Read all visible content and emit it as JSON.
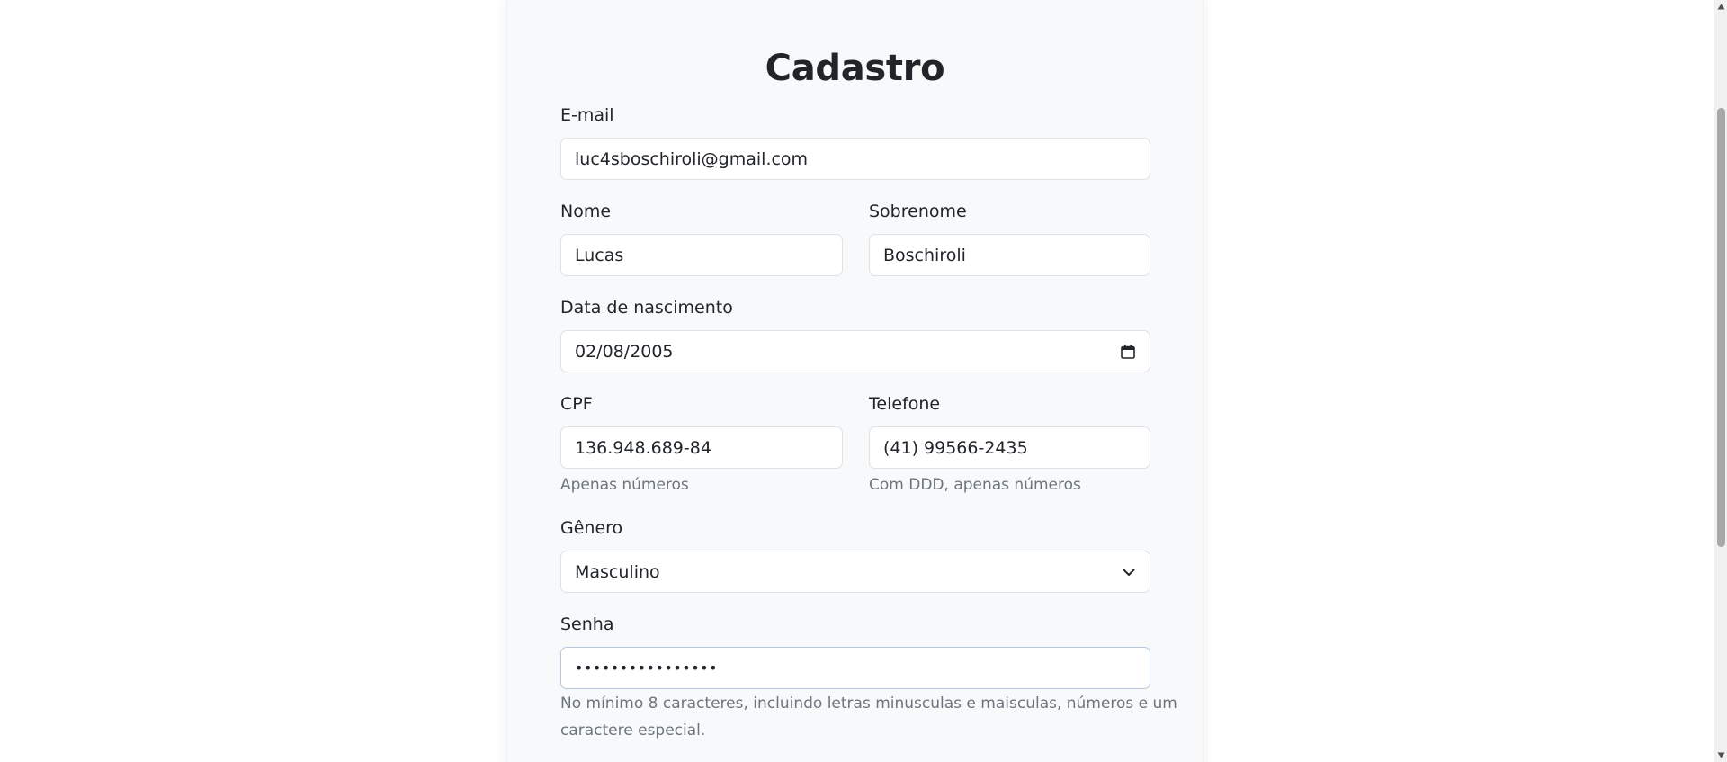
{
  "form": {
    "title": "Cadastro",
    "email": {
      "label": "E-mail",
      "value": "luc4sboschiroli@gmail.com"
    },
    "nome": {
      "label": "Nome",
      "value": "Lucas"
    },
    "sobrenome": {
      "label": "Sobrenome",
      "value": "Boschiroli"
    },
    "nascimento": {
      "label": "Data de nascimento",
      "value": "02/08/2005",
      "icon": "calendar-icon"
    },
    "cpf": {
      "label": "CPF",
      "value": "136.948.689-84",
      "help": "Apenas números"
    },
    "telefone": {
      "label": "Telefone",
      "value": "(41) 99566-2435",
      "help": "Com DDD, apenas números"
    },
    "genero": {
      "label": "Gênero",
      "value": "Masculino",
      "icon": "chevron-down-icon"
    },
    "senha": {
      "label": "Senha",
      "value": "••••••••••••••••",
      "help_line1": "No mínimo 8 caracteres, incluindo letras minusculas e maisculas, números e um",
      "help_line2": "caractere especial."
    }
  },
  "colors": {
    "card_bg": "#f8f9fa",
    "input_border": "#dee2e6",
    "focus_border": "#b8c7dc",
    "muted_text": "#6c757d"
  },
  "scrollbar": {
    "position_fraction": 0.12
  }
}
